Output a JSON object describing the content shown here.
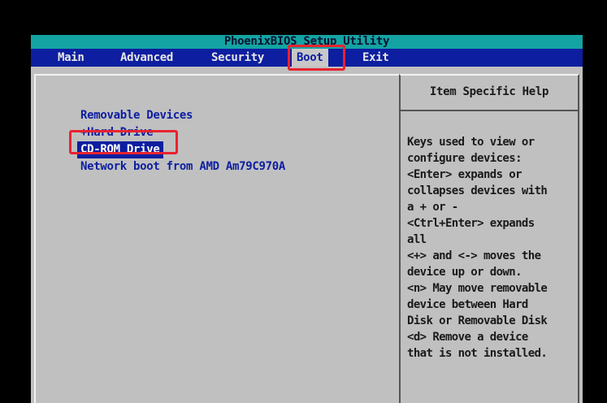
{
  "title": "PhoenixBIOS Setup Utility",
  "menu": {
    "items": [
      {
        "label": "Main"
      },
      {
        "label": "Advanced"
      },
      {
        "label": "Security"
      },
      {
        "label": "Boot"
      },
      {
        "label": "Exit"
      }
    ],
    "active": "Boot"
  },
  "boot_devices": [
    {
      "label": "Removable Devices"
    },
    {
      "label": "+Hard Drive"
    },
    {
      "label": "CD-ROM Drive"
    },
    {
      "label": "Network boot from AMD Am79C970A"
    }
  ],
  "help": {
    "header": "Item Specific Help",
    "lines": [
      "Keys used to view or",
      "configure devices:",
      "<Enter> expands or",
      "collapses devices with",
      "a + or -",
      "<Ctrl+Enter> expands",
      "all",
      "<+> and <-> moves the",
      "device up or down.",
      "<n> May move removable",
      "device between Hard",
      "Disk or Removable Disk",
      "<d> Remove a device",
      "that is not installed."
    ]
  },
  "colors": {
    "title_bar": "#14a3a3",
    "menu_bar": "#0d1ea0",
    "panel_bg": "#c0c0c0",
    "highlight_annotation": "#e8232f"
  }
}
